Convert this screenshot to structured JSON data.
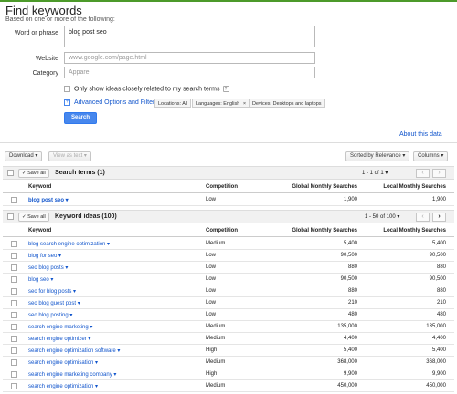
{
  "page": {
    "title": "Find keywords",
    "subtitle": "Based on one or more of the following:"
  },
  "form": {
    "word_label": "Word or phrase",
    "word_value": "blog post seo",
    "website_label": "Website",
    "website_placeholder": "www.google.com/page.html",
    "category_label": "Category",
    "category_placeholder": "Apparel",
    "only_show_label": "Only show ideas closely related to my search terms",
    "advanced_label": "Advanced Options and Filters",
    "chips": [
      "Locations: All",
      "Languages: English",
      "Devices: Desktops and laptops"
    ],
    "search_label": "Search"
  },
  "about_link": "About this data",
  "toolbar": {
    "download_label": "Download",
    "view_as_text_label": "View as text",
    "sorted_label": "Sorted by Relevance",
    "columns_label": "Columns"
  },
  "search_terms": {
    "save_all_label": "Save all",
    "title": "Search terms (1)",
    "pager": "1 - 1 of 1",
    "columns": [
      "Keyword",
      "Competition",
      "Global Monthly Searches",
      "Local Monthly Searches"
    ],
    "rows": [
      {
        "keyword": "blog post seo",
        "competition": "Low",
        "global": "1,900",
        "local": "1,900"
      }
    ]
  },
  "keyword_ideas": {
    "save_all_label": "Save all",
    "title": "Keyword ideas (100)",
    "pager": "1 - 50 of 100",
    "columns": [
      "Keyword",
      "Competition",
      "Global Monthly Searches",
      "Local Monthly Searches"
    ],
    "rows": [
      {
        "keyword": "blog search engine optimization",
        "competition": "Medium",
        "global": "5,400",
        "local": "5,400"
      },
      {
        "keyword": "blog for seo",
        "competition": "Low",
        "global": "90,500",
        "local": "90,500"
      },
      {
        "keyword": "seo blog posts",
        "competition": "Low",
        "global": "880",
        "local": "880"
      },
      {
        "keyword": "blog seo",
        "competition": "Low",
        "global": "90,500",
        "local": "90,500"
      },
      {
        "keyword": "seo for blog posts",
        "competition": "Low",
        "global": "880",
        "local": "880"
      },
      {
        "keyword": "seo blog guest post",
        "competition": "Low",
        "global": "210",
        "local": "210"
      },
      {
        "keyword": "seo blog posting",
        "competition": "Low",
        "global": "480",
        "local": "480"
      },
      {
        "keyword": "search engine marketing",
        "competition": "Medium",
        "global": "135,000",
        "local": "135,000"
      },
      {
        "keyword": "search engine optimizer",
        "competition": "Medium",
        "global": "4,400",
        "local": "4,400"
      },
      {
        "keyword": "search engine optimization software",
        "competition": "High",
        "global": "5,400",
        "local": "5,400"
      },
      {
        "keyword": "search engine optimisation",
        "competition": "Medium",
        "global": "368,000",
        "local": "368,000"
      },
      {
        "keyword": "search engine marketing company",
        "competition": "High",
        "global": "9,900",
        "local": "9,900"
      },
      {
        "keyword": "search engine optimization",
        "competition": "Medium",
        "global": "450,000",
        "local": "450,000"
      }
    ]
  },
  "colors": {
    "accent": "#4787ed",
    "link": "#1155cc",
    "topbar": "#4c9a2a"
  }
}
